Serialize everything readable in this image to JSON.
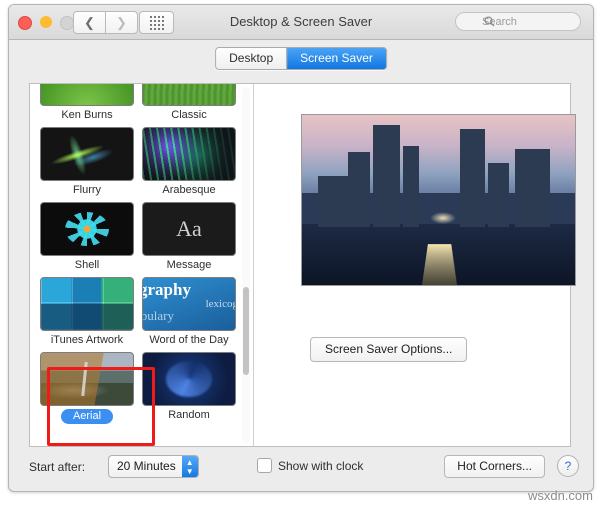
{
  "window": {
    "title": "Desktop & Screen Saver",
    "traffic_lights": [
      "close-red",
      "minimize-yellow",
      "zoom-disabled-gray"
    ],
    "back_icon": "chevron-left-icon",
    "forward_icon": "chevron-right-icon",
    "grid_icon": "show-all-grid-icon"
  },
  "search": {
    "placeholder": "Search",
    "icon": "search-icon",
    "value": ""
  },
  "tabs": [
    {
      "label": "Desktop",
      "active": false
    },
    {
      "label": "Screen Saver",
      "active": true
    }
  ],
  "screensavers": [
    {
      "label": "Ken Burns",
      "art": "art-grass",
      "selected": false
    },
    {
      "label": "Classic",
      "art": "art-grass2",
      "selected": false
    },
    {
      "label": "Flurry",
      "art": "art-flurry",
      "selected": false
    },
    {
      "label": "Arabesque",
      "art": "art-arab",
      "selected": false
    },
    {
      "label": "Shell",
      "art": "art-shell",
      "selected": false
    },
    {
      "label": "Message",
      "art": "art-msg",
      "selected": false
    },
    {
      "label": "iTunes Artwork",
      "art": "art-itunes",
      "selected": false
    },
    {
      "label": "Word of the Day",
      "art": "art-word",
      "selected": false
    },
    {
      "label": "Aerial",
      "art": "art-aerial",
      "selected": true
    },
    {
      "label": "Random",
      "art": "art-random",
      "selected": false
    }
  ],
  "message_thumb_glyph": "Aa",
  "word_of_day_words": [
    "graphy",
    "lexicog",
    "abulary"
  ],
  "preview": {
    "description": "city skyline at dusk with lit boulevard",
    "options_button": "Screen Saver Options..."
  },
  "bottom": {
    "start_after_label": "Start after:",
    "start_after_value": "20 Minutes",
    "show_with_clock_label": "Show with clock",
    "show_with_clock_checked": false,
    "hot_corners_button": "Hot Corners...",
    "help_button": "?"
  },
  "annotation": {
    "color": "#ee1b18",
    "target": "Aerial"
  },
  "watermark": "wsxdn.com",
  "colors": {
    "accent_blue": "#1277e3",
    "selected_pill": "#3b8ff0",
    "annotation_red": "#ee1b18",
    "window_bg": "#ececec"
  }
}
